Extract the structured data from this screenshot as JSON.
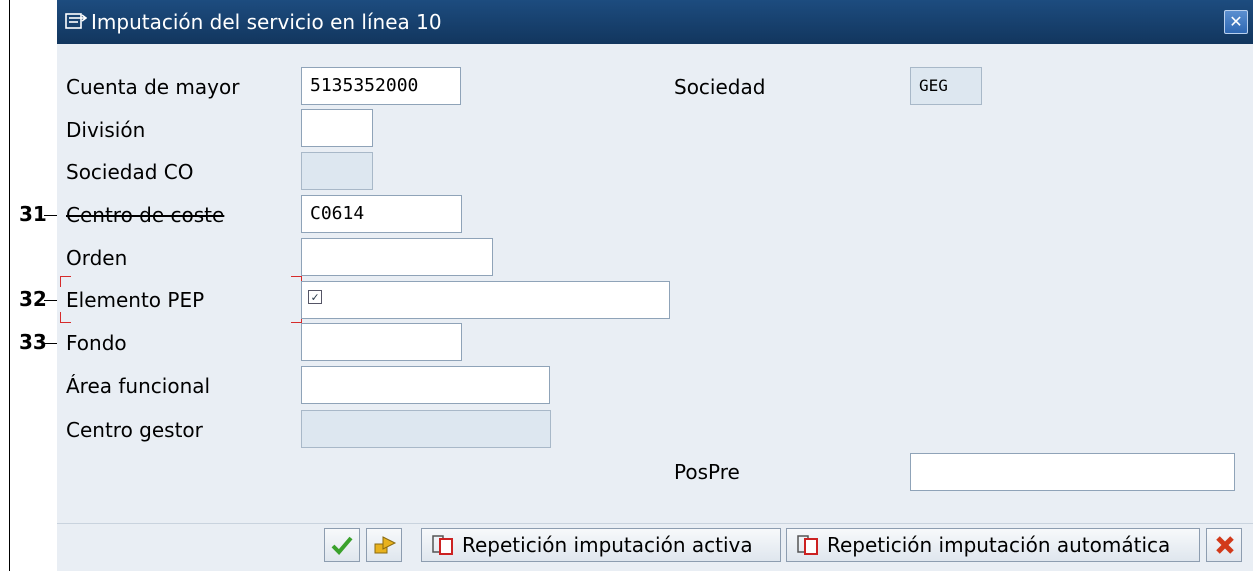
{
  "dialog": {
    "title": "Imputación del servicio en línea 10"
  },
  "form": {
    "cuenta_mayor": {
      "label": "Cuenta de mayor",
      "value": "5135352000"
    },
    "division": {
      "label": "División",
      "value": ""
    },
    "sociedad_co": {
      "label": "Sociedad CO",
      "value": ""
    },
    "centro_coste": {
      "label": "Centro de coste",
      "value": "C0614"
    },
    "orden": {
      "label": "Orden",
      "value": ""
    },
    "elemento_pep": {
      "label": "Elemento PEP",
      "value": ""
    },
    "fondo": {
      "label": "Fondo",
      "value": ""
    },
    "area_funcional": {
      "label": "Área funcional",
      "value": ""
    },
    "centro_gestor": {
      "label": "Centro gestor",
      "value": ""
    },
    "sociedad": {
      "label": "Sociedad",
      "value": "GEG"
    },
    "pospre": {
      "label": "PosPre",
      "value": ""
    }
  },
  "callouts": {
    "c31": "31",
    "c32": "32",
    "c33": "33"
  },
  "buttons": {
    "repeticion_activa": "Repetición imputación activa",
    "repeticion_automatica": "Repetición imputación automática"
  },
  "colors": {
    "title_bar": "#1d4c7f",
    "dialog_bg": "#e9eef4",
    "readonly_field": "#dde7f0",
    "focus_marker": "#d62b2b",
    "confirm_green": "#3aa12c",
    "cancel_red": "#d23a1a"
  },
  "icons": {
    "title": "dialog-icon",
    "close": "close-icon",
    "confirm": "checkmark-icon",
    "next": "next-arrow-icon",
    "repeat": "copy-icon",
    "cancel": "cancel-x-icon"
  }
}
